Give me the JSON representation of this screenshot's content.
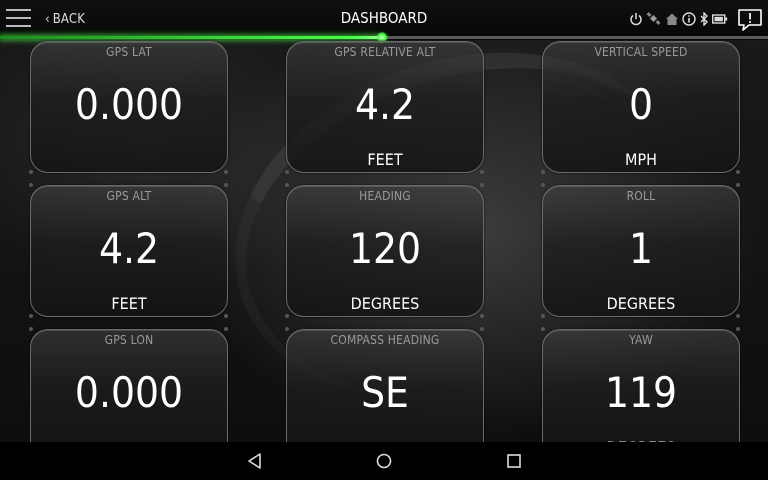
{
  "header": {
    "back_label": "BACK",
    "title": "DASHBOARD",
    "status_icons": [
      "power-icon",
      "satellite-icon",
      "home-icon",
      "info-icon",
      "bluetooth-icon",
      "battery-icon"
    ],
    "feedback_icon": "feedback-icon"
  },
  "progress": {
    "fraction": 0.5,
    "color": "#49ff49"
  },
  "tiles": [
    {
      "label": "GPS LAT",
      "value": "0.000",
      "unit": ""
    },
    {
      "label": "GPS RELATIVE ALT",
      "value": "4.2",
      "unit": "FEET"
    },
    {
      "label": "VERTICAL SPEED",
      "value": "0",
      "unit": "MPH"
    },
    {
      "label": "GPS ALT",
      "value": "4.2",
      "unit": "FEET"
    },
    {
      "label": "HEADING",
      "value": "120",
      "unit": "DEGREES"
    },
    {
      "label": "ROLL",
      "value": "1",
      "unit": "DEGREES"
    },
    {
      "label": "GPS LON",
      "value": "0.000",
      "unit": ""
    },
    {
      "label": "COMPASS HEADING",
      "value": "SE",
      "unit": ""
    },
    {
      "label": "YAW",
      "value": "119",
      "unit": "DEGREES"
    }
  ],
  "navbar": {
    "buttons": [
      "back-triangle-icon",
      "home-circle-icon",
      "recents-square-icon"
    ]
  }
}
